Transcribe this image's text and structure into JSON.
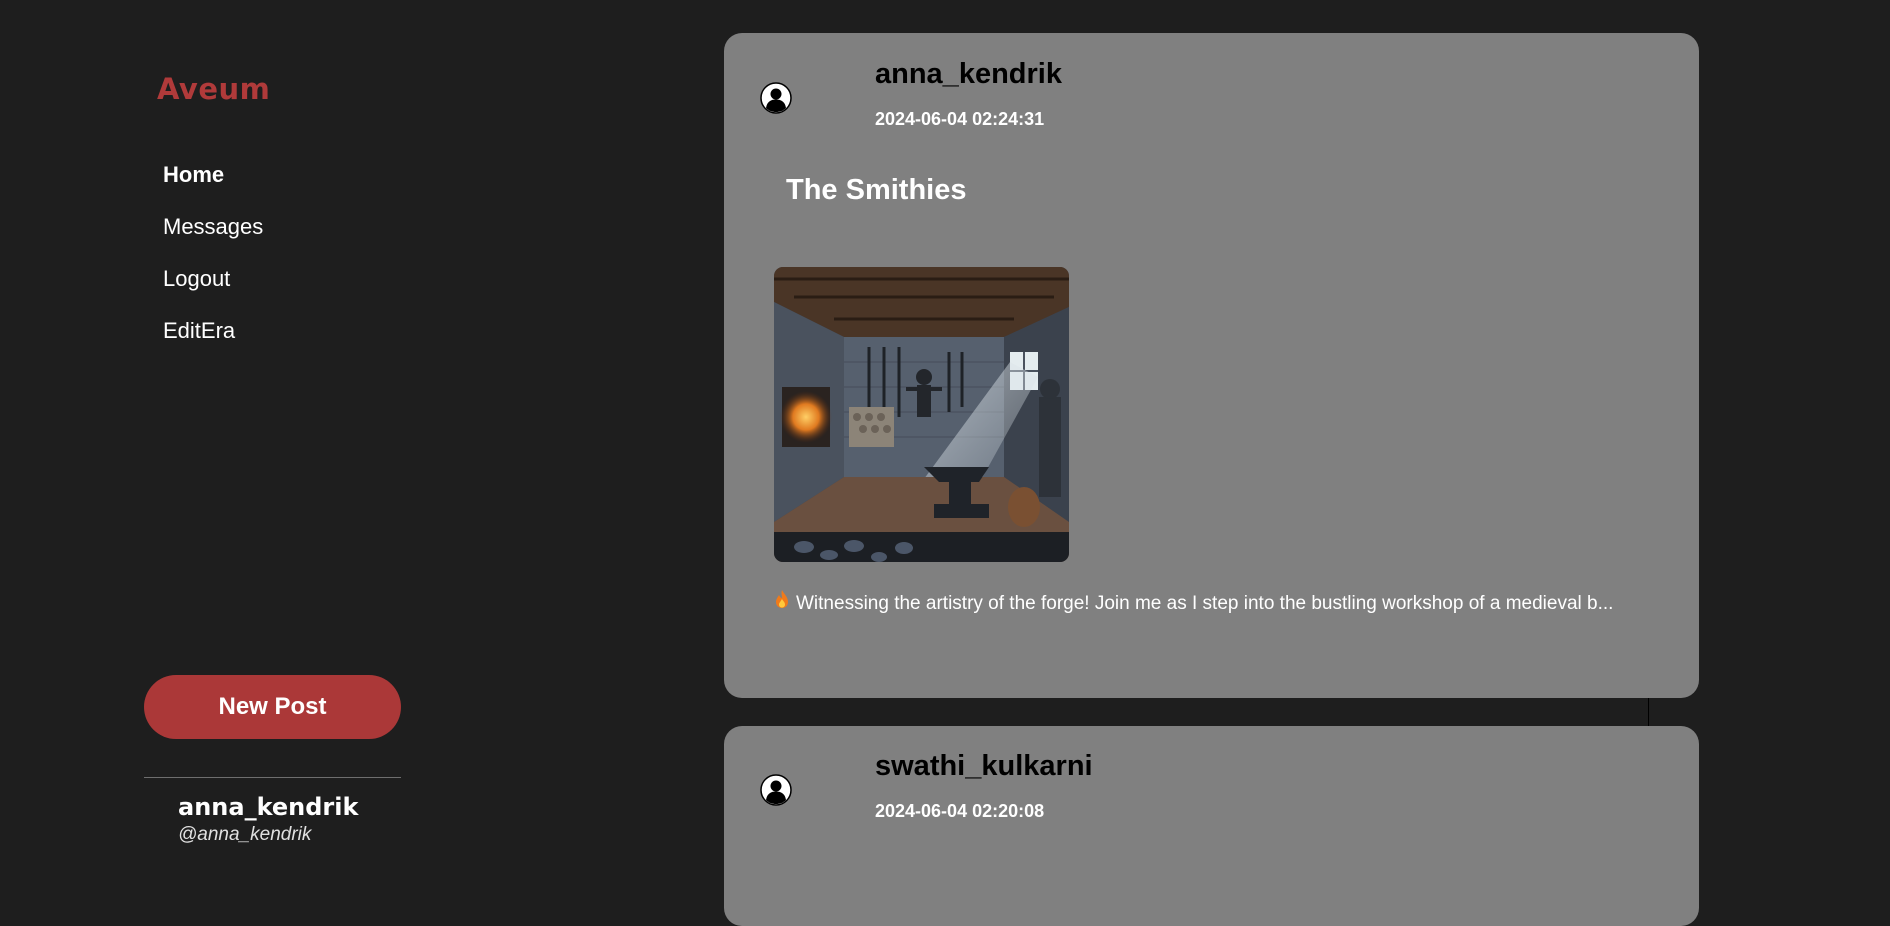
{
  "sidebar": {
    "brand": "Aveum",
    "nav": [
      {
        "label": "Home",
        "active": true
      },
      {
        "label": "Messages"
      },
      {
        "label": "Logout"
      },
      {
        "label": "EditEra"
      }
    ],
    "new_post_label": "New Post",
    "profile": {
      "name": "anna_kendrik",
      "handle": "@anna_kendrik"
    }
  },
  "colors": {
    "brand": "#b03a3a",
    "button": "#ab3838",
    "background": "#1e1e1e",
    "card": "#808080"
  },
  "feed": {
    "posts": [
      {
        "username": "anna_kendrik",
        "timestamp": "2024-06-04 02:24:31",
        "title": "The Smithies",
        "image": "medieval-forge-workshop",
        "text": "Witnessing the artistry of the forge! Join me as I step into the bustling workshop of a medieval b..."
      },
      {
        "username": "swathi_kulkarni",
        "timestamp": "2024-06-04 02:20:08"
      }
    ]
  }
}
